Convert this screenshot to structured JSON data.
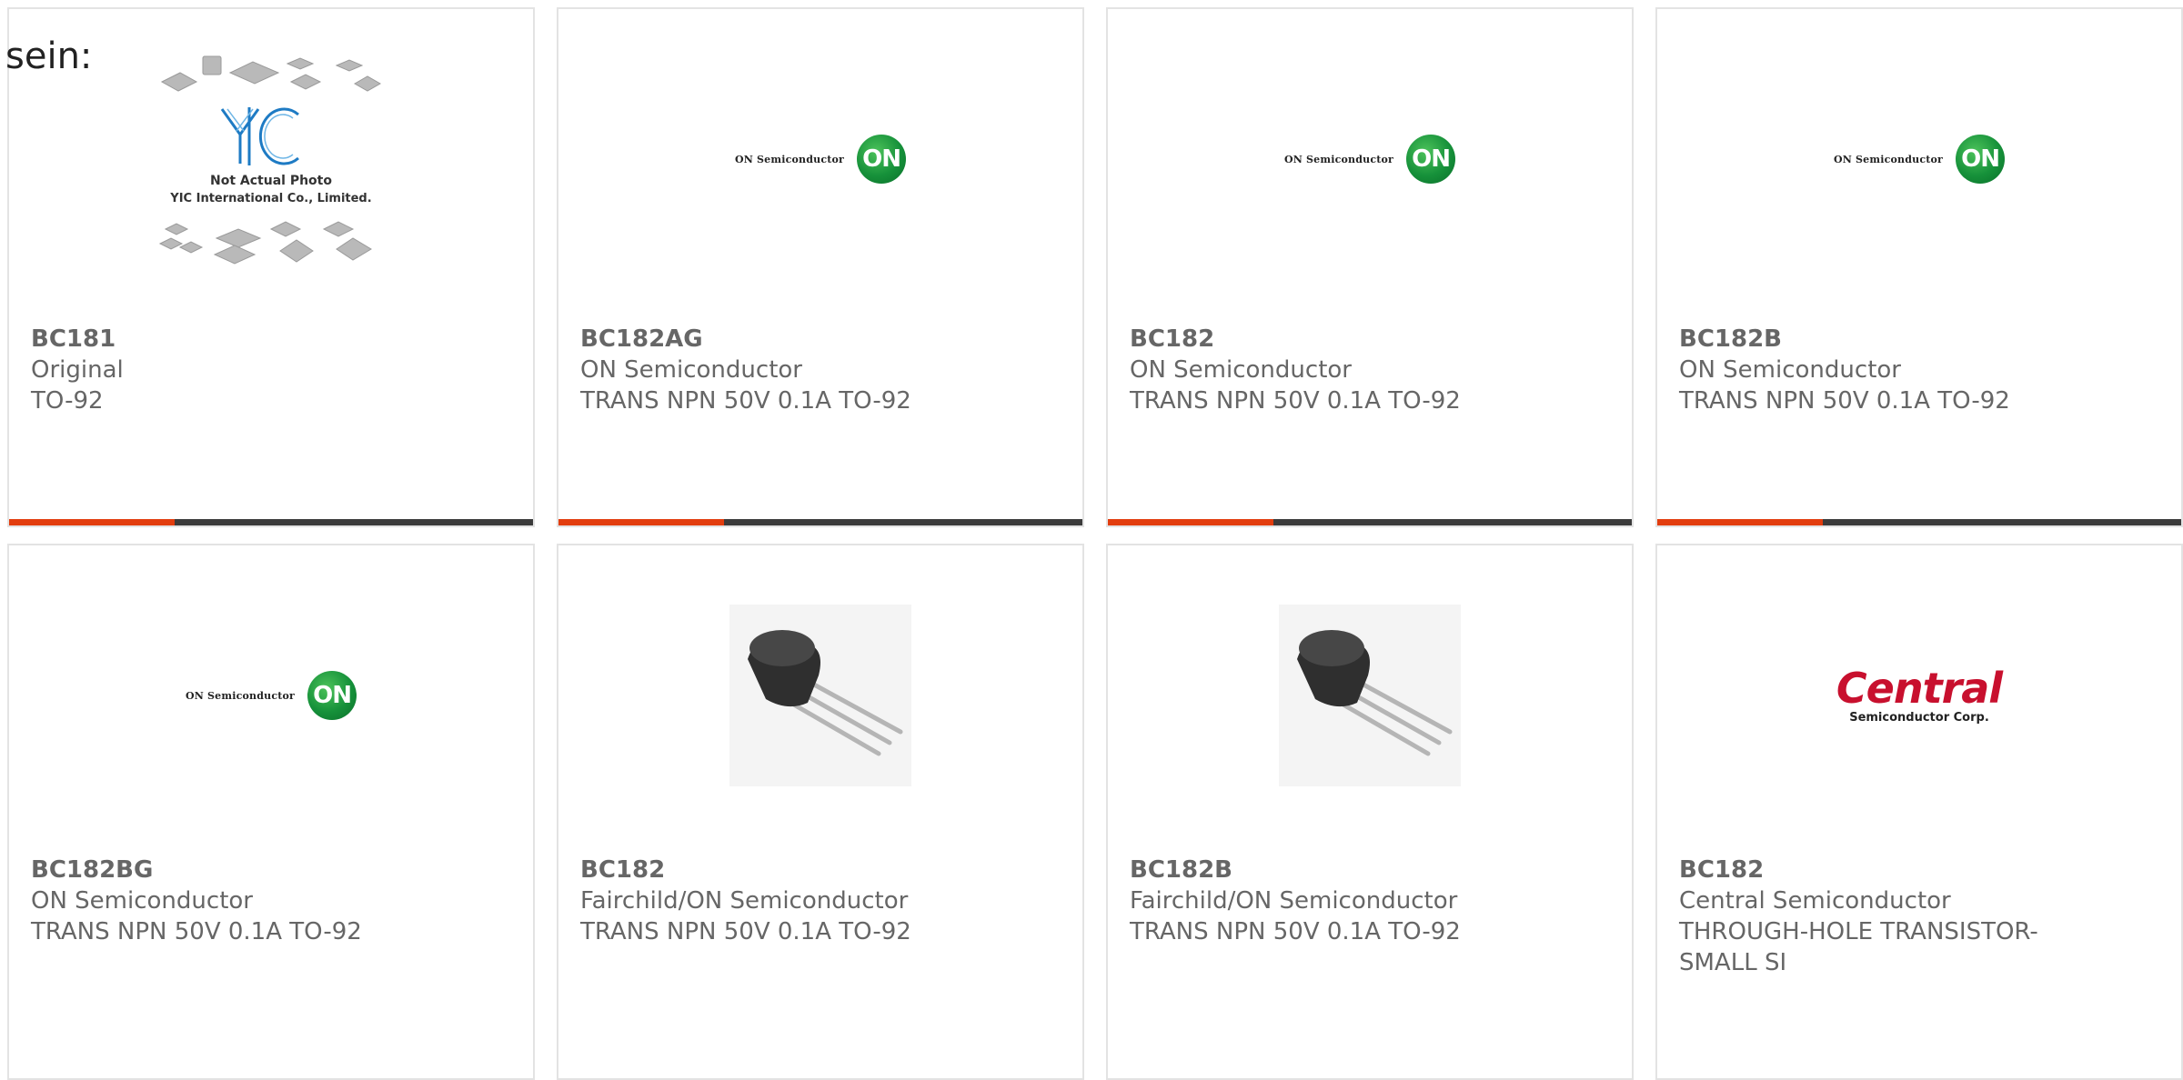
{
  "heading": "sein:",
  "colors": {
    "accent": "#e23d0e",
    "bar": "#3b3b3b",
    "card_border": "#e3e3e3",
    "text": "#666666"
  },
  "products": [
    {
      "part": "BC181",
      "manufacturer": "Original",
      "description": "TO-92",
      "image": "yic-placeholder-photo",
      "image_text": [
        "Not Actual Photo",
        "YIC International Co., Limited."
      ]
    },
    {
      "part": "BC182AG",
      "manufacturer": "ON Semiconductor",
      "description": "TRANS NPN 50V 0.1A TO-92",
      "image": "on-semiconductor-logo",
      "logo_text": "ON Semiconductor",
      "logo_mark": "ON"
    },
    {
      "part": "BC182",
      "manufacturer": "ON Semiconductor",
      "description": "TRANS NPN 50V 0.1A TO-92",
      "image": "on-semiconductor-logo",
      "logo_text": "ON Semiconductor",
      "logo_mark": "ON"
    },
    {
      "part": "BC182B",
      "manufacturer": "ON Semiconductor",
      "description": "TRANS NPN 50V 0.1A TO-92",
      "image": "on-semiconductor-logo",
      "logo_text": "ON Semiconductor",
      "logo_mark": "ON"
    },
    {
      "part": "BC182BG",
      "manufacturer": "ON Semiconductor",
      "description": "TRANS NPN 50V 0.1A TO-92",
      "image": "on-semiconductor-logo",
      "logo_text": "ON Semiconductor",
      "logo_mark": "ON"
    },
    {
      "part": "BC182",
      "manufacturer": "Fairchild/ON Semiconductor",
      "description": "TRANS NPN 50V 0.1A TO-92",
      "image": "to92-transistor-photo"
    },
    {
      "part": "BC182B",
      "manufacturer": "Fairchild/ON Semiconductor",
      "description": "TRANS NPN 50V 0.1A TO-92",
      "image": "to92-transistor-photo"
    },
    {
      "part": "BC182",
      "manufacturer": "Central Semiconductor",
      "description": "THROUGH-HOLE TRANSISTOR-SMALL SI",
      "image": "central-semiconductor-logo",
      "logo_text": "Central",
      "logo_sub": "Semiconductor Corp."
    }
  ]
}
